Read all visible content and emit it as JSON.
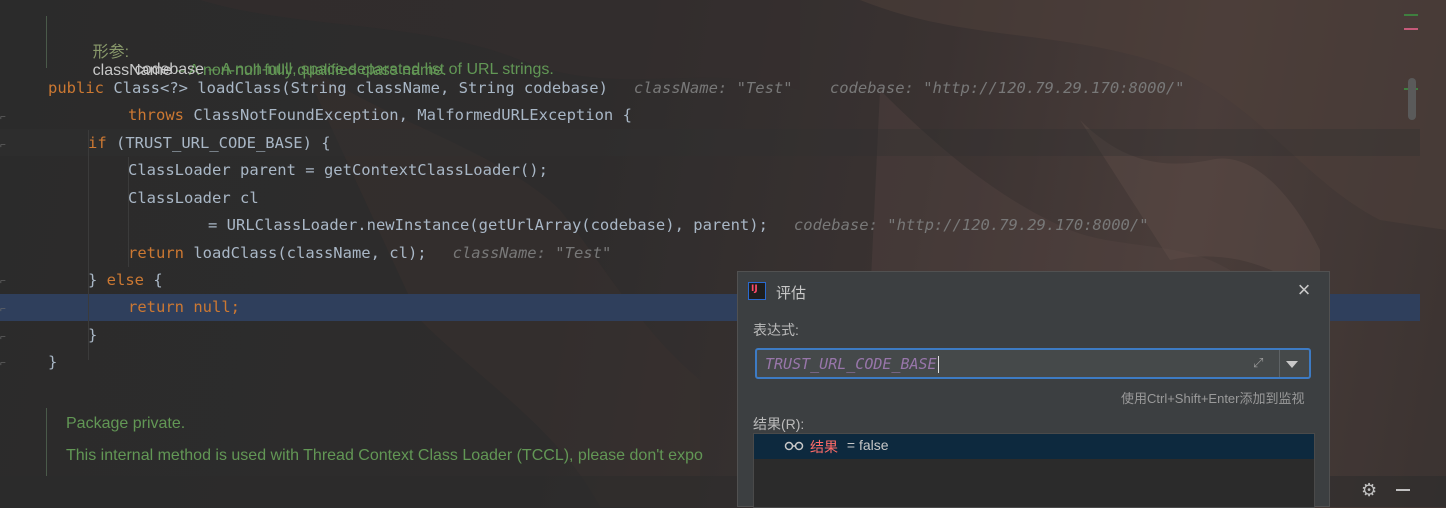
{
  "doc_top": {
    "tag": "形参:",
    "params": [
      {
        "name": "className",
        "desc": " – A non-null fully qualified class name."
      },
      {
        "name": "codebase",
        "desc": " – A non-null, space-separated list of URL strings."
      }
    ]
  },
  "code": {
    "l1_a": "public",
    "l1_b": " Class<?> loadClass(String className, String codebase)",
    "l1_hint": "className: \"Test\"    codebase: \"http://120.79.29.170:8000/\"",
    "l2_a": "throws",
    "l2_b": " ClassNotFoundException, MalformedURLException {",
    "l3_a": "if",
    "l3_b": " (TRUST_URL_CODE_BASE) {",
    "l4": "ClassLoader parent = getContextClassLoader();",
    "l5": "ClassLoader cl",
    "l6": "= URLClassLoader.newInstance(getUrlArray(codebase), parent);",
    "l6_hint": "codebase: \"http://120.79.29.170:8000/\"",
    "l7_a": "return",
    "l7_b": " loadClass(className, cl);",
    "l7_hint": "className: \"Test\"",
    "l8_a": "} ",
    "l8_b": "else",
    "l8_c": " {",
    "l9_a": "return",
    "l9_b": " null",
    "l9_c": ";",
    "l10": "}",
    "l11": "}"
  },
  "doc_bottom": {
    "line1": "Package private.",
    "line2": "This internal method is used with Thread Context Class Loader (TCCL), please don't expo"
  },
  "dialog": {
    "title": "评估",
    "expression_label": "表达式:",
    "expression_value": "TRUST_URL_CODE_BASE",
    "hint": "使用Ctrl+Shift+Enter添加到监视",
    "result_label": "结果(R):",
    "result_name": "结果",
    "result_value": " = false"
  },
  "colors": {
    "keyword": "#cc7832",
    "constant": "#9876aa",
    "doc": "#629755",
    "selection": "#2f3f5c"
  }
}
